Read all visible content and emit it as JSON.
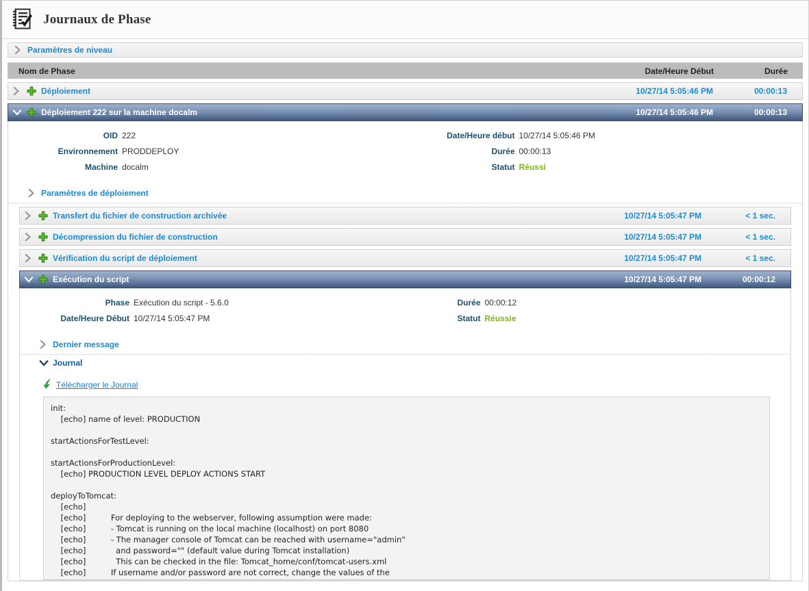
{
  "page": {
    "title": "Journaux de Phase",
    "icon": "notepad-check-icon"
  },
  "level_params": {
    "label": "Paramètres de niveau",
    "expanded": false
  },
  "columns": {
    "name": "Nom de Phase",
    "start": "Date/Heure Début",
    "duration": "Durée"
  },
  "rows": [
    {
      "label": "Déploiement",
      "start": "10/27/14 5:05:46 PM",
      "duration": "00:00:13",
      "selected": false,
      "expanded": false
    },
    {
      "label": "Déploiement 222 sur la machine docalm",
      "start": "10/27/14 5:05:46 PM",
      "duration": "00:00:13",
      "selected": true,
      "expanded": true
    }
  ],
  "deployment_detail": {
    "oid_label": "OID",
    "oid_value": "222",
    "env_label": "Environnement",
    "env_value": "PRODDEPLOY",
    "machine_label": "Machine",
    "machine_value": "docalm",
    "start_label": "Date/Heure début",
    "start_value": "10/27/14 5:05:46 PM",
    "duration_label": "Durée",
    "duration_value": "00:00:13",
    "status_label": "Statut",
    "status_value": "Réussi",
    "params_label": "Paramètres de déploiement"
  },
  "subphases": [
    {
      "label": "Transfert du fichier de construction archivée",
      "start": "10/27/14 5:05:47 PM",
      "duration": "< 1 sec.",
      "selected": false,
      "expanded": false
    },
    {
      "label": "Décompression du fichier de construction",
      "start": "10/27/14 5:05:47 PM",
      "duration": "< 1 sec.",
      "selected": false,
      "expanded": false
    },
    {
      "label": "Vérification du script de déploiement",
      "start": "10/27/14 5:05:47 PM",
      "duration": "< 1 sec.",
      "selected": false,
      "expanded": false
    },
    {
      "label": "Exécution du script",
      "start": "10/27/14 5:05:47 PM",
      "duration": "00:00:12",
      "selected": true,
      "expanded": true
    }
  ],
  "script_detail": {
    "phase_label": "Phase",
    "phase_value": "Exécution du script - 5.6.0",
    "start_label": "Date/Heure Début",
    "start_value": "10/27/14 5:05:47 PM",
    "duration_label": "Durée",
    "duration_value": "00:00:12",
    "status_label": "Statut",
    "status_value": "Réussie",
    "last_message_label": "Dernier message",
    "journal_label": "Journal",
    "download_label": "Télécharger le Journal",
    "download_icon": "green-download-arrow-icon"
  },
  "log": "init:\n    [echo] name of level: PRODUCTION\n\nstartActionsForTestLevel:\n\nstartActionsForProductionLevel:\n    [echo] PRODUCTION LEVEL DEPLOY ACTIONS START\n\ndeployToTomcat:\n    [echo]\n    [echo]          For deploying to the webserver, following assumption were made:\n    [echo]          - Tomcat is running on the local machine (localhost) on port 8080\n    [echo]          - The manager console of Tomcat can be reached with username=\"admin\"\n    [echo]            and password=\"\" (default value during Tomcat installation)\n    [echo]            This can be checked in the file: Tomcat_home/conf/tomcat-users.xml\n    [echo]          If username and/or password are not correct, change the values of the",
  "colors": {
    "link": "#1b8ad4",
    "label": "#19516e",
    "success": "#7cb518",
    "selected_row_dark": "#41587d",
    "header_grey": "#bcbcbc"
  }
}
